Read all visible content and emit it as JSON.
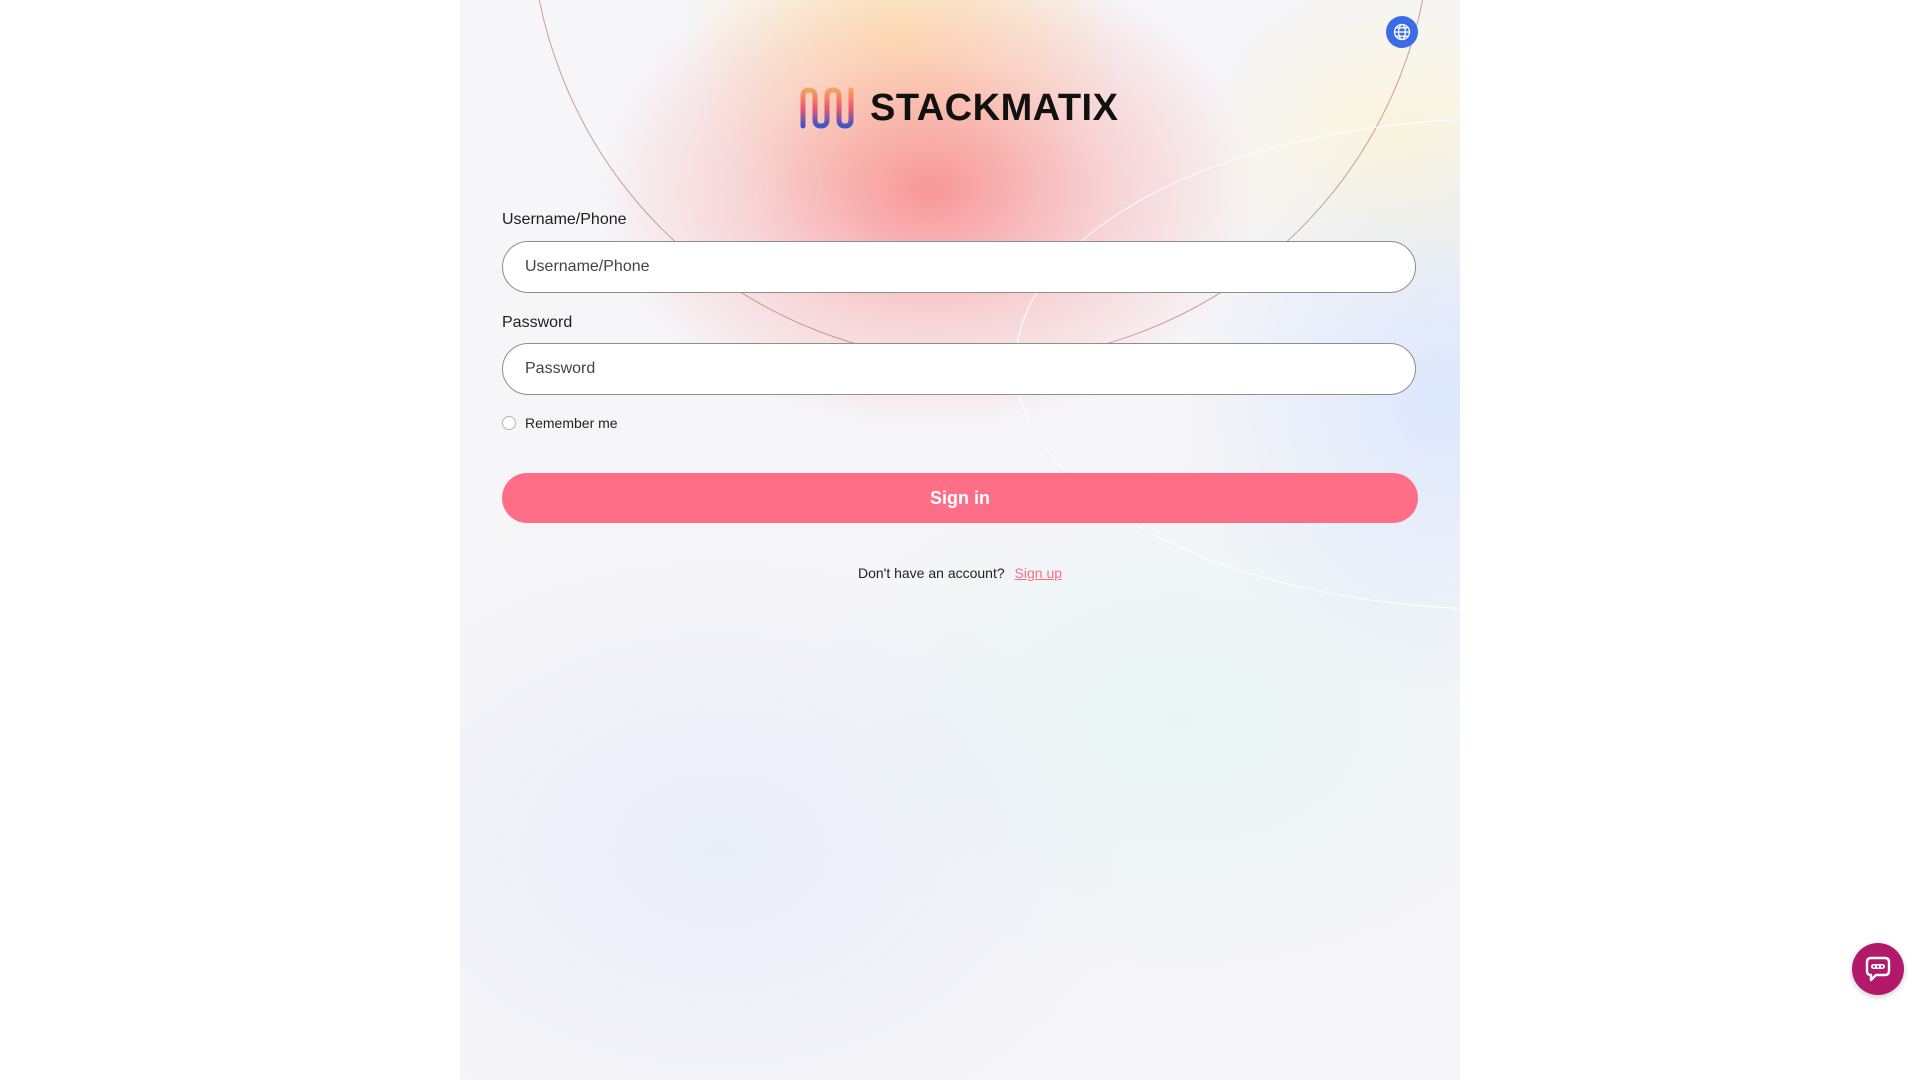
{
  "brand": {
    "name": "STACKMATIX"
  },
  "form": {
    "username_label": "Username/Phone",
    "username_placeholder": "Username/Phone",
    "username_value": "",
    "password_label": "Password",
    "password_placeholder": "Password",
    "password_value": "",
    "remember_label": "Remember me",
    "remember_checked": false,
    "signin_label": "Sign in"
  },
  "signup": {
    "prompt": "Don't have an account?",
    "link_label": "Sign up"
  },
  "icons": {
    "language": "globe-icon",
    "chat": "chat-bubble-icon"
  },
  "colors": {
    "accent": "#ff6e87",
    "globe_bg": "#3b6ce6",
    "chat_bg": "#b3196a"
  }
}
